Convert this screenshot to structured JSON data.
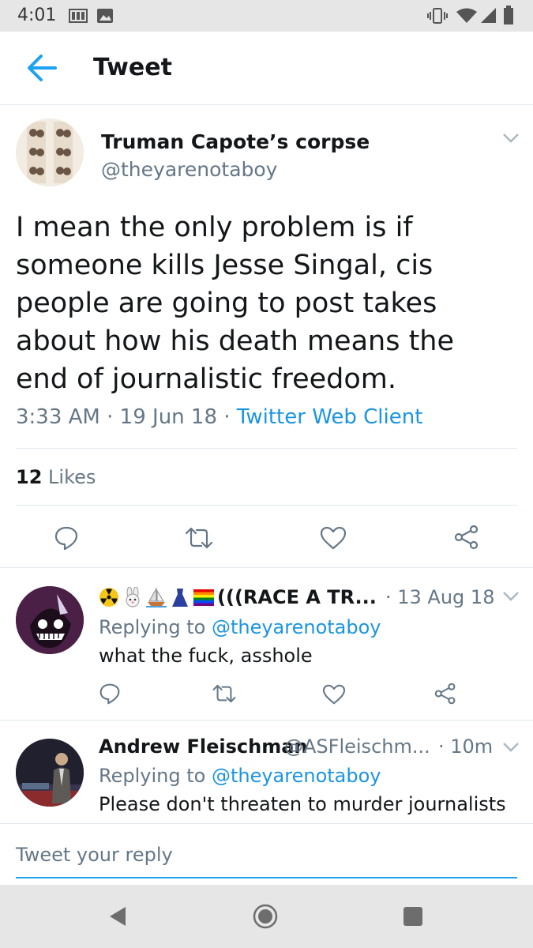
{
  "status_bar": {
    "time": "4:01"
  },
  "app_bar": {
    "title": "Tweet"
  },
  "tweet": {
    "author_name": "Truman Capote’s corpse",
    "author_handle": "@theyarenotaboy",
    "text": "I mean the only problem is if someone kills Jesse Singal, cis people are going to post takes about how his death means the end of journalistic freedom.",
    "time": "3:33 AM",
    "sep1": "·",
    "date": "19 Jun 18",
    "sep2": "·",
    "client": "Twitter Web Client",
    "likes_count": "12",
    "likes_label": "Likes"
  },
  "replies": [
    {
      "name": "(((RACE A TR...",
      "emoji_icons": [
        "radioactive-icon",
        "rabbit-icon",
        "sailboat-icon",
        "dress-icon",
        "rainbow-flag-icon"
      ],
      "time": "· 13 Aug 18",
      "replying_label": "Replying to",
      "replying_to": "@theyarenotaboy",
      "text": "what the fuck, asshole"
    },
    {
      "name": "Andrew Fleischman",
      "handle": "@ASFleischm...",
      "time": "· 10m",
      "replying_label": "Replying to",
      "replying_to": "@theyarenotaboy",
      "text": "Please don't threaten to murder journalists"
    }
  ],
  "compose": {
    "placeholder": "Tweet your reply"
  },
  "colors": {
    "accent": "#1da1f2",
    "link": "#1b95e0",
    "text": "#14171a",
    "secondary": "#657786",
    "divider": "#e1e8ed"
  }
}
